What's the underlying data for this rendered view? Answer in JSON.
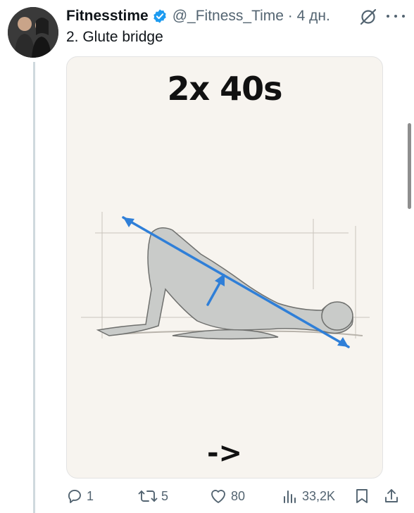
{
  "tweet": {
    "display_name": "Fitnesstime",
    "handle": "@_Fitness_Time",
    "separator": "·",
    "time": "4 дн.",
    "text": "2. Glute bridge"
  },
  "media": {
    "title": "2x 40s",
    "arrow": "->"
  },
  "actions": {
    "replies": "1",
    "retweets": "5",
    "likes": "80",
    "views": "33,2K"
  },
  "colors": {
    "verified": "#1d9bf0",
    "muted": "#536471",
    "arrow_overlay": "#2f7fd8"
  },
  "icons": [
    "verified-badge-icon",
    "grok-icon",
    "more-icon",
    "reply-icon",
    "retweet-icon",
    "like-icon",
    "views-icon",
    "bookmark-icon",
    "share-icon"
  ]
}
